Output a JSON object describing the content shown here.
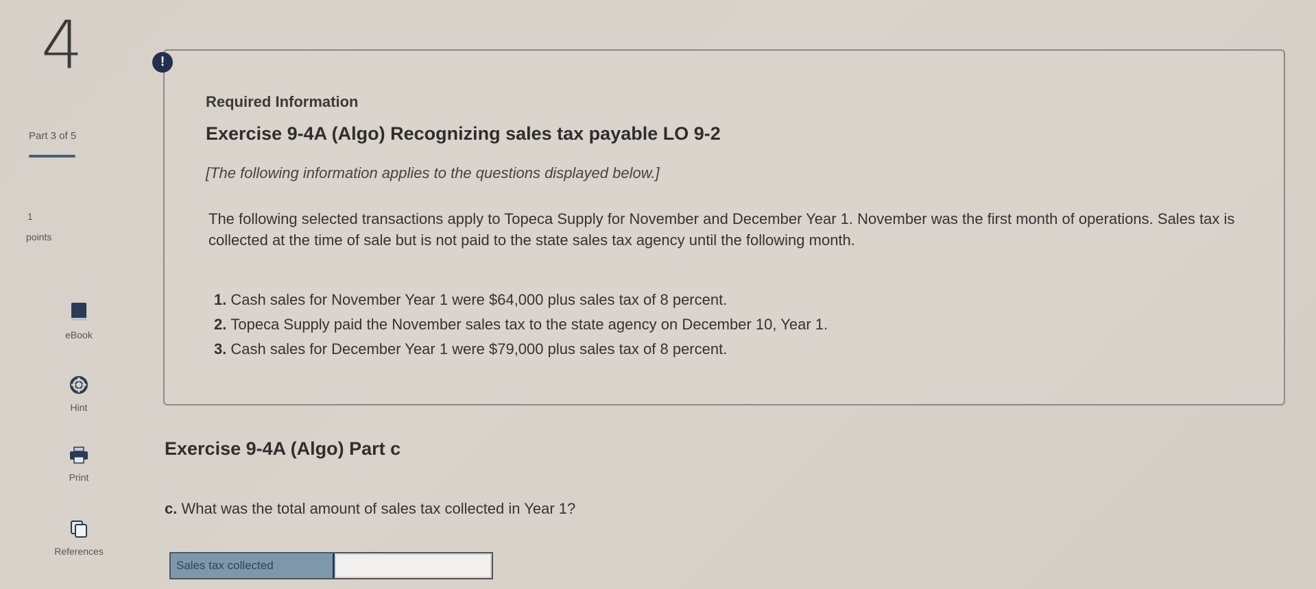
{
  "sidebar": {
    "question_number": "4",
    "part_label": "Part 3 of 5",
    "points_value": "1",
    "points_label": "points",
    "tools": [
      {
        "label": "eBook",
        "icon": "book-icon"
      },
      {
        "label": "Hint",
        "icon": "lifebuoy-icon"
      },
      {
        "label": "Print",
        "icon": "printer-icon"
      },
      {
        "label": "References",
        "icon": "copy-icon"
      }
    ]
  },
  "alert_icon": "!",
  "info": {
    "heading": "Required Information",
    "title": "Exercise 9-4A (Algo) Recognizing sales tax payable LO 9-2",
    "note": "[The following information applies to the questions displayed below.]",
    "paragraph": "The following selected transactions apply to Topeca Supply for November and December Year 1. November was the first month of operations. Sales tax is collected at the time of sale but is not paid to the state sales tax agency until the following month.",
    "transactions": [
      {
        "num": "1.",
        "text": "Cash sales for November Year 1 were $64,000 plus sales tax of 8 percent."
      },
      {
        "num": "2.",
        "text": "Topeca Supply paid the November sales tax to the state agency on December 10, Year 1."
      },
      {
        "num": "3.",
        "text": "Cash sales for December Year 1 were $79,000 plus sales tax of 8 percent."
      }
    ]
  },
  "part": {
    "heading": "Exercise 9-4A (Algo) Part c",
    "question_letter": "c.",
    "question_text": "What was the total amount of sales tax collected in Year 1?",
    "answer_label": "Sales tax collected",
    "answer_value": ""
  },
  "colors": {
    "accent": "#232f4e",
    "answer_label_bg": "#7d98ab",
    "background": "#d6d0c8"
  }
}
